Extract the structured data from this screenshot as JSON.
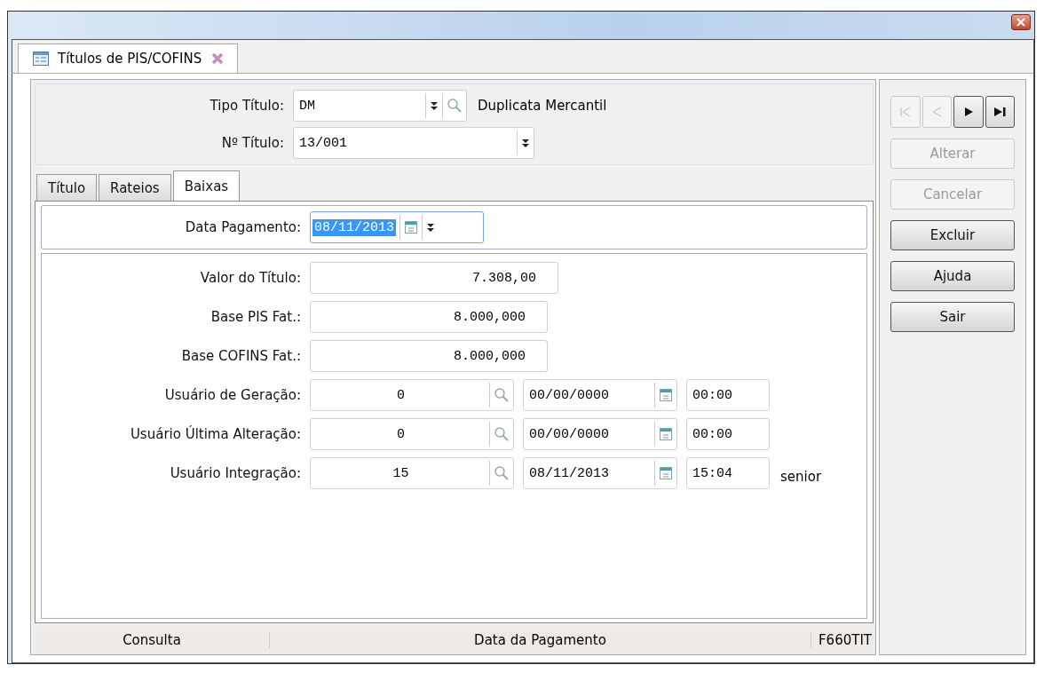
{
  "document_tab": {
    "title": "Títulos de PIS/COFINS"
  },
  "header": {
    "tipo_titulo": {
      "label": "Tipo Título:",
      "value": "DM",
      "description": "Duplicata Mercantil"
    },
    "numero_titulo": {
      "label": "Nº Título:",
      "value": "13/001"
    }
  },
  "tabs": [
    {
      "label": "Título",
      "selected": false
    },
    {
      "label": "Rateios",
      "selected": false
    },
    {
      "label": "Baixas",
      "selected": true
    }
  ],
  "data_pagamento": {
    "label": "Data Pagamento:",
    "value": "08/11/2013",
    "highlighted": true
  },
  "amounts": [
    {
      "label": "Valor do Título:",
      "value": "7.308,00"
    },
    {
      "label": "Base PIS Fat.:",
      "value": "8.000,000"
    },
    {
      "label": "Base COFINS Fat.:",
      "value": "8.000,000"
    }
  ],
  "users": [
    {
      "label": "Usuário de Geração:",
      "code": "0",
      "date": "00/00/0000",
      "time": "00:00"
    },
    {
      "label": "Usuário Última Alteração:",
      "code": "0",
      "date": "00/00/0000",
      "time": "00:00"
    },
    {
      "label": "Usuário Integração:",
      "code": "15",
      "date": "08/11/2013",
      "time": "15:04",
      "name": "senior"
    }
  ],
  "nav_buttons": [
    {
      "kind": "first",
      "disabled": true
    },
    {
      "kind": "previous",
      "disabled": true
    },
    {
      "kind": "next",
      "disabled": false
    },
    {
      "kind": "last",
      "disabled": false
    }
  ],
  "buttons": [
    {
      "label": "Alterar",
      "disabled": true
    },
    {
      "label": "Cancelar",
      "disabled": true
    },
    {
      "label": "Excluir",
      "disabled": false
    },
    {
      "label": "Ajuda",
      "disabled": false
    },
    {
      "label": "Sair",
      "disabled": false
    }
  ],
  "status_bar": {
    "mode": "Consulta",
    "hint": "Data da Pagamento",
    "form_code": "F660TIT"
  }
}
